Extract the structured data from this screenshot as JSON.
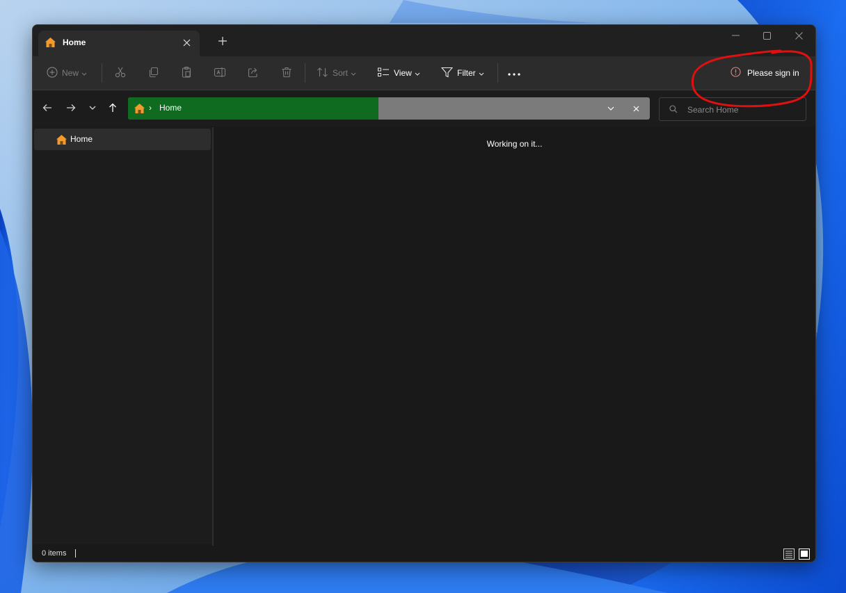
{
  "window": {
    "tab": {
      "title": "Home",
      "close_icon": "close-icon"
    },
    "new_tab_icon": "plus-icon",
    "controls": [
      "minimize-icon",
      "maximize-icon",
      "close-icon"
    ]
  },
  "toolbar": {
    "new_label": "New",
    "sort_label": "Sort",
    "view_label": "View",
    "filter_label": "Filter",
    "more_icon": "more-icon",
    "signin_label": "Please sign in",
    "signin_icon": "warning-circle-icon",
    "icons": [
      "cut-icon",
      "copy-icon",
      "paste-icon",
      "rename-icon",
      "share-icon",
      "delete-icon"
    ]
  },
  "navigation": {
    "address": {
      "crumb_separator": "›",
      "crumb": "Home"
    },
    "loading_progress": 0.48,
    "search": {
      "placeholder": "Search Home",
      "value": ""
    }
  },
  "sidebar": {
    "items": [
      {
        "label": "Home",
        "icon": "home-icon"
      }
    ]
  },
  "main": {
    "status_text": "Working on it..."
  },
  "statusbar": {
    "item_count": "0 items"
  },
  "colors": {
    "window_bg": "#191919",
    "toolbar_bg": "#2c2c2c",
    "progress_green": "#0f6b1f",
    "annotation_red": "#e01010",
    "home_icon_orange": "#f29a2c"
  }
}
